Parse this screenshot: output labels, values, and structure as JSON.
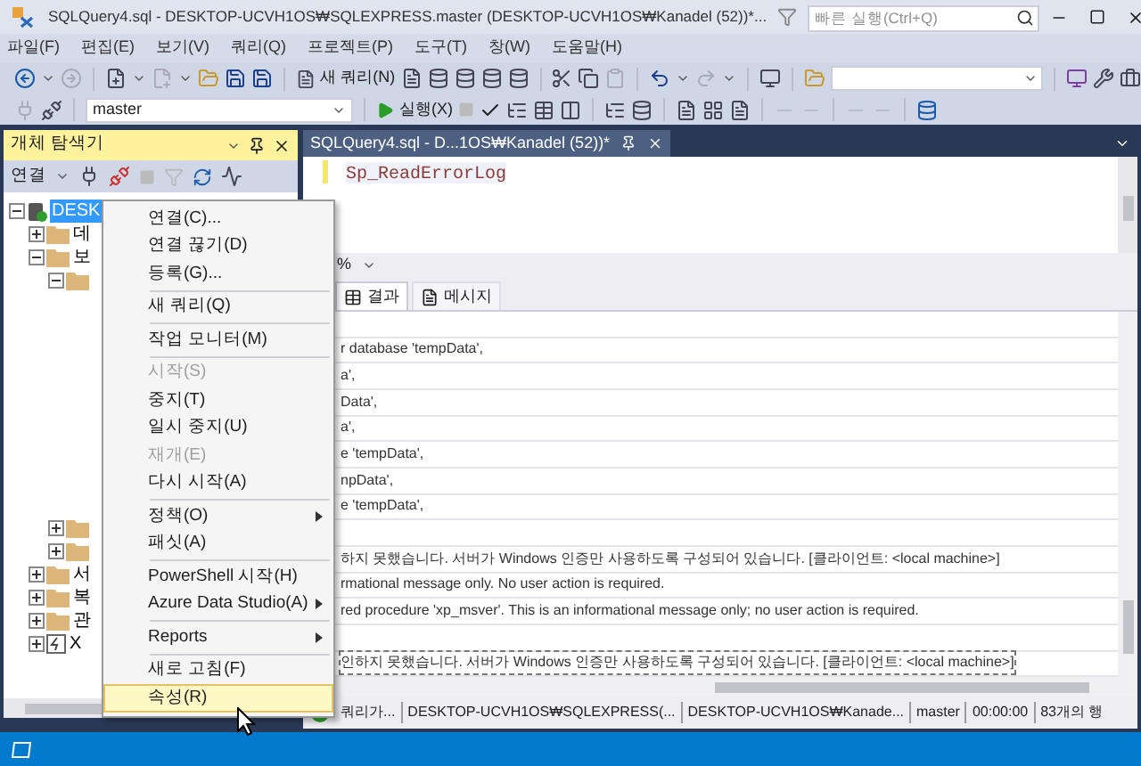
{
  "window": {
    "title": "SQLQuery4.sql - DESKTOP-UCVH1OS₩SQLEXPRESS.master (DESKTOP-UCVH1OS₩Kanadel (52))*...",
    "quick_launch": {
      "placeholder": "빠른 실행(Ctrl+Q)"
    }
  },
  "menu": [
    "파일(F)",
    "편집(E)",
    "보기(V)",
    "쿼리(Q)",
    "프로젝트(P)",
    "도구(T)",
    "창(W)",
    "도움말(H)"
  ],
  "toolbar": {
    "new_query": "새 쿼리(N)",
    "database": "master",
    "execute": "실행(X)"
  },
  "object_explorer": {
    "title": "개체 탐색기",
    "connect": "연결",
    "tree": [
      {
        "kind": "server",
        "label": "DESK",
        "expanded": true,
        "selected": true,
        "children": [
          {
            "kind": "folder",
            "label": "데",
            "expanded": false,
            "selected": false
          },
          {
            "kind": "folder",
            "label": "보",
            "expanded": true,
            "selected": false,
            "children": [
              {
                "kind": "folder",
                "expanded": true,
                "selected": false
              },
              {
                "kind": "folder",
                "expanded": false,
                "selected": false
              },
              {
                "kind": "folder",
                "expanded": false,
                "selected": false
              }
            ]
          },
          {
            "kind": "folder",
            "label": "서",
            "expanded": false,
            "selected": false
          },
          {
            "kind": "folder",
            "label": "복",
            "expanded": false,
            "selected": false
          },
          {
            "kind": "folder",
            "label": "관",
            "expanded": false,
            "selected": false
          },
          {
            "kind": "profiler",
            "label": "X",
            "expanded": false,
            "selected": false
          }
        ]
      }
    ]
  },
  "context_menu": [
    {
      "kind": "item",
      "label": "연결(C)...",
      "disabled": false,
      "submenu": false,
      "selected": false
    },
    {
      "kind": "item",
      "label": "연결 끊기(D)",
      "disabled": false,
      "submenu": false,
      "selected": false
    },
    {
      "kind": "item",
      "label": "등록(G)...",
      "disabled": false,
      "submenu": false,
      "selected": false
    },
    {
      "kind": "separator"
    },
    {
      "kind": "item",
      "label": "새 쿼리(Q)",
      "disabled": false,
      "submenu": false,
      "selected": false
    },
    {
      "kind": "separator"
    },
    {
      "kind": "item",
      "label": "작업 모니터(M)",
      "disabled": false,
      "submenu": false,
      "selected": false
    },
    {
      "kind": "separator"
    },
    {
      "kind": "item",
      "label": "시작(S)",
      "disabled": true,
      "submenu": false,
      "selected": false
    },
    {
      "kind": "item",
      "label": "중지(T)",
      "disabled": false,
      "submenu": false,
      "selected": false
    },
    {
      "kind": "item",
      "label": "일시 중지(U)",
      "disabled": false,
      "submenu": false,
      "selected": false
    },
    {
      "kind": "item",
      "label": "재개(E)",
      "disabled": true,
      "submenu": false,
      "selected": false
    },
    {
      "kind": "item",
      "label": "다시 시작(A)",
      "disabled": false,
      "submenu": false,
      "selected": false
    },
    {
      "kind": "separator"
    },
    {
      "kind": "item",
      "label": "정책(O)",
      "disabled": false,
      "submenu": true,
      "selected": false
    },
    {
      "kind": "item",
      "label": "패싯(A)",
      "disabled": false,
      "submenu": false,
      "selected": false
    },
    {
      "kind": "separator"
    },
    {
      "kind": "item",
      "label": "PowerShell 시작(H)",
      "disabled": false,
      "submenu": false,
      "selected": false
    },
    {
      "kind": "item",
      "label": "Azure Data Studio(A)",
      "disabled": false,
      "submenu": true,
      "selected": false
    },
    {
      "kind": "separator"
    },
    {
      "kind": "item",
      "label": "Reports",
      "disabled": false,
      "submenu": true,
      "selected": false
    },
    {
      "kind": "separator"
    },
    {
      "kind": "item",
      "label": "새로 고침(F)",
      "disabled": false,
      "submenu": false,
      "selected": false
    },
    {
      "kind": "item",
      "label": "속성(R)",
      "disabled": false,
      "submenu": false,
      "selected": true
    }
  ],
  "editor": {
    "tab": "SQLQuery4.sql - D...1OS₩Kanadel (52))*",
    "code": "Sp_ReadErrorLog",
    "zoom": "%"
  },
  "results": {
    "tabs": [
      {
        "label": "결과",
        "selected": true
      },
      {
        "label": "메시지",
        "selected": false
      }
    ],
    "rows": [
      {
        "selected": false
      },
      {
        "text": "r database 'tempData',",
        "selected": false
      },
      {
        "text": "a',",
        "selected": false
      },
      {
        "text": "Data',",
        "selected": false
      },
      {
        "text": "a',",
        "selected": false
      },
      {
        "text": "e 'tempData',",
        "selected": false
      },
      {
        "text": "npData',",
        "selected": false
      },
      {
        "text": "e 'tempData',",
        "selected": false
      },
      {
        "selected": false
      },
      {
        "text": "하지 못했습니다. 서버가 Windows 인증만 사용하도록 구성되어 있습니다. [클라이언트: <local machine>]",
        "selected": false
      },
      {
        "text": "rmational message only. No user action is required.",
        "selected": false
      },
      {
        "text": "red procedure 'xp_msver'. This is an informational message only; no user action is required.",
        "selected": false
      },
      {
        "selected": false
      },
      {
        "text": "인하지 못했습니다. 서버가 Windows 인증만 사용하도록 구성되어 있습니다. [클라이언트: <local machine>]",
        "selected": true
      }
    ]
  },
  "status": [
    "쿼리가...",
    "DESKTOP-UCVH1OS₩SQLEXPRESS(...",
    "DESKTOP-UCVH1OS₩Kanade...",
    "master",
    "00:00:00",
    "83개의 행"
  ]
}
